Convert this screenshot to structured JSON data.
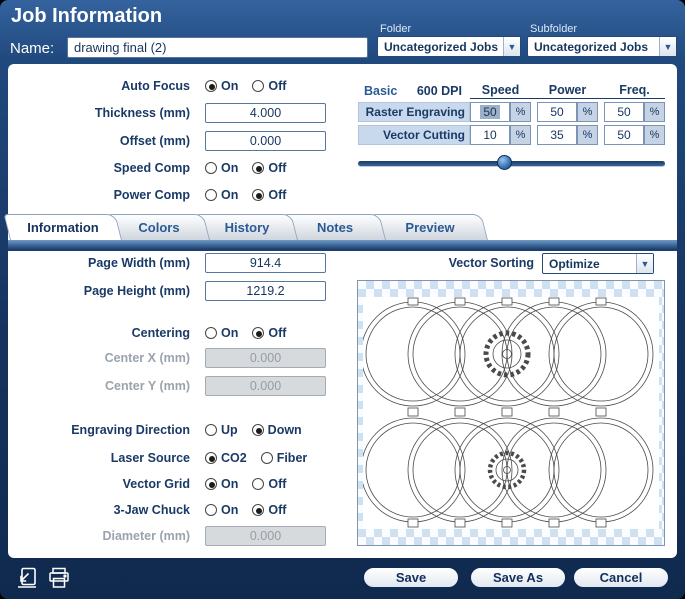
{
  "header": {
    "title": "Job Information",
    "name_label": "Name:",
    "name_value": "drawing final (2)",
    "folder_label": "Folder",
    "folder_value": "Uncategorized Jobs",
    "subfolder_label": "Subfolder",
    "subfolder_value": "Uncategorized Jobs"
  },
  "icons": {
    "dropdown_arrow": "▼"
  },
  "settings": {
    "auto_focus_label": "Auto Focus",
    "auto_focus_on": "On",
    "auto_focus_off": "Off",
    "auto_focus_selected": "On",
    "thickness_label": "Thickness (mm)",
    "thickness_value": "4.000",
    "offset_label": "Offset (mm)",
    "offset_value": "0.000",
    "speed_comp_label": "Speed Comp",
    "speed_comp_on": "On",
    "speed_comp_off": "Off",
    "speed_comp_selected": "Off",
    "power_comp_label": "Power Comp",
    "power_comp_on": "On",
    "power_comp_off": "Off",
    "power_comp_selected": "Off"
  },
  "laser_table": {
    "basic_label": "Basic",
    "dpi_label": "600 DPI",
    "col_speed": "Speed",
    "col_power": "Power",
    "col_freq": "Freq.",
    "percent": "%",
    "rows": [
      {
        "label": "Raster Engraving",
        "speed": "50",
        "power": "50",
        "freq": "50"
      },
      {
        "label": "Vector Cutting",
        "speed": "10",
        "power": "35",
        "freq": "50"
      }
    ]
  },
  "tabs": {
    "active": "Information",
    "items": [
      {
        "label": "Information"
      },
      {
        "label": "Colors"
      },
      {
        "label": "History"
      },
      {
        "label": "Notes"
      },
      {
        "label": "Preview"
      }
    ]
  },
  "info": {
    "page_width_label": "Page Width (mm)",
    "page_width_value": "914.4",
    "page_height_label": "Page Height (mm)",
    "page_height_value": "1219.2",
    "vector_sorting_label": "Vector Sorting",
    "vector_sorting_value": "Optimize",
    "centering_label": "Centering",
    "centering_on": "On",
    "centering_off": "Off",
    "centering_selected": "Off",
    "center_x_label": "Center X (mm)",
    "center_x_value": "0.000",
    "center_y_label": "Center Y (mm)",
    "center_y_value": "0.000",
    "engraving_direction_label": "Engraving Direction",
    "engraving_up": "Up",
    "engraving_down": "Down",
    "engraving_selected": "Down",
    "laser_source_label": "Laser Source",
    "laser_co2": "CO2",
    "laser_fiber": "Fiber",
    "laser_selected": "CO2",
    "vector_grid_label": "Vector Grid",
    "vector_grid_on": "On",
    "vector_grid_off": "Off",
    "vector_grid_selected": "On",
    "jaw_chuck_label": "3-Jaw Chuck",
    "jaw_chuck_on": "On",
    "jaw_chuck_off": "Off",
    "jaw_chuck_selected": "Off",
    "diameter_label": "Diameter (mm)",
    "diameter_value": "0.000"
  },
  "footer": {
    "save_label": "Save",
    "save_as_label": "Save As",
    "cancel_label": "Cancel"
  }
}
